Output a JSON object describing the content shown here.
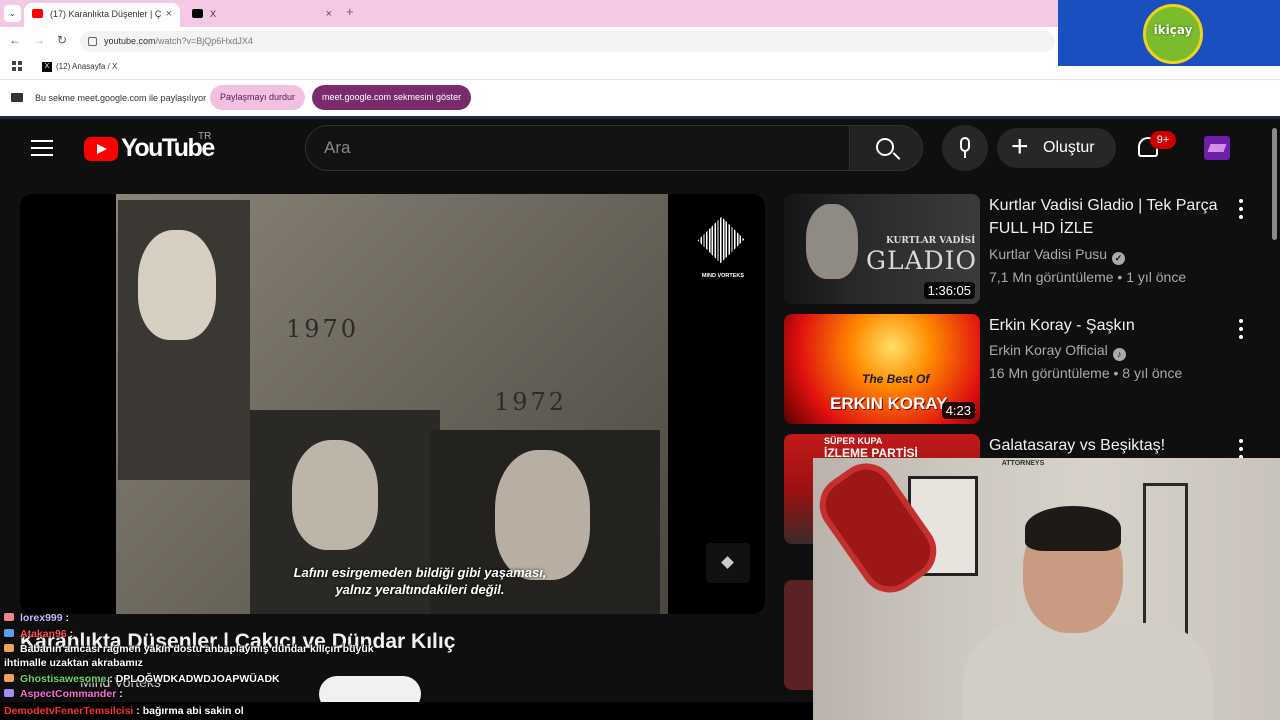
{
  "browser": {
    "tabs": [
      {
        "title": "(17) Karanlıkta Düşenler | Ç",
        "active": true
      },
      {
        "title": "X",
        "active": false
      }
    ],
    "new_tab": "+",
    "dropdown": "⌄",
    "close": "×",
    "url_host": "youtube.com",
    "url_path": "/watch?v=BjQp6HxdJX4",
    "bookmark": {
      "icon_text": "X",
      "label": "(12) Anasayfa / X"
    },
    "share_bar": {
      "message": "Bu sekme meet.google.com ile paylaşılıyor",
      "stop_label": "Paylaşmayı durdur",
      "show_label": "meet.google.com sekmesini göster"
    }
  },
  "overlay_logo": {
    "text": "ikiçay"
  },
  "youtube": {
    "logo_text": "YouTube",
    "region": "TR",
    "search_placeholder": "Ara",
    "create_label": "Oluştur",
    "notification_count": "9+",
    "player": {
      "subtitle_line1": "Lafını esirgemeden bildiği gibi yaşaması,",
      "subtitle_line2": "yalnız yeraltındakileri değil.",
      "watermark": "MIND VORTEKS",
      "photo_year_a": "1970",
      "photo_year_b": "1972"
    },
    "video_title": "Karanlıkta Düşenler | Çakıcı ve Dündar Kılıç",
    "channel_name": "Mind Vorteks",
    "recommendations": [
      {
        "title": "Kurtlar Vadisi Gladio | Tek Parça FULL HD İZLE",
        "channel": "Kurtlar Vadisi Pusu",
        "meta": "7,1 Mn görüntüleme • 1 yıl önce",
        "duration": "1:36:05",
        "thumb_text_a": "KURTLAR VADİSİ",
        "thumb_text_b": "GLADIO"
      },
      {
        "title": "Erkin Koray - Şaşkın",
        "channel": "Erkin Koray Official",
        "meta": "16 Mn görüntüleme • 8 yıl önce",
        "duration": "4:23",
        "thumb_text_a": "The Best Of",
        "thumb_text_b": "ERKIN KORAY"
      },
      {
        "title": "Galatasaray vs Beşiktaş!",
        "thumb_text_a": "SÜPER KUPA",
        "thumb_text_b": "İZLEME PARTİSİ"
      }
    ]
  },
  "webcam": {
    "sign_text": "ATTORNEYS"
  },
  "chat": [
    {
      "user": "lorex999",
      "message": ""
    },
    {
      "user": "Atakan96",
      "message": ""
    },
    {
      "user": "",
      "message": "Babanın amcası rağmen yakın dostu ahbaplaymış dündar kılıçın büyük"
    },
    {
      "user": "",
      "message": "ihtimalle uzaktan akrabamız"
    },
    {
      "user": "Ghostisawesome",
      "message": "DPLOĞWDKADWDJOAPWÜADK"
    },
    {
      "user": "AspectCommander",
      "message": ""
    },
    {
      "user": "DemodetvFenerTemsilcisi",
      "message": "bağırma abi sakin ol"
    }
  ],
  "colors": {
    "yt_bg": "#0f0f0f",
    "yt_red": "#ff0000",
    "tabbar_pink": "#f4c9e6",
    "share_button": "#7a2b6c",
    "logo_blue": "#1a4fbf"
  }
}
